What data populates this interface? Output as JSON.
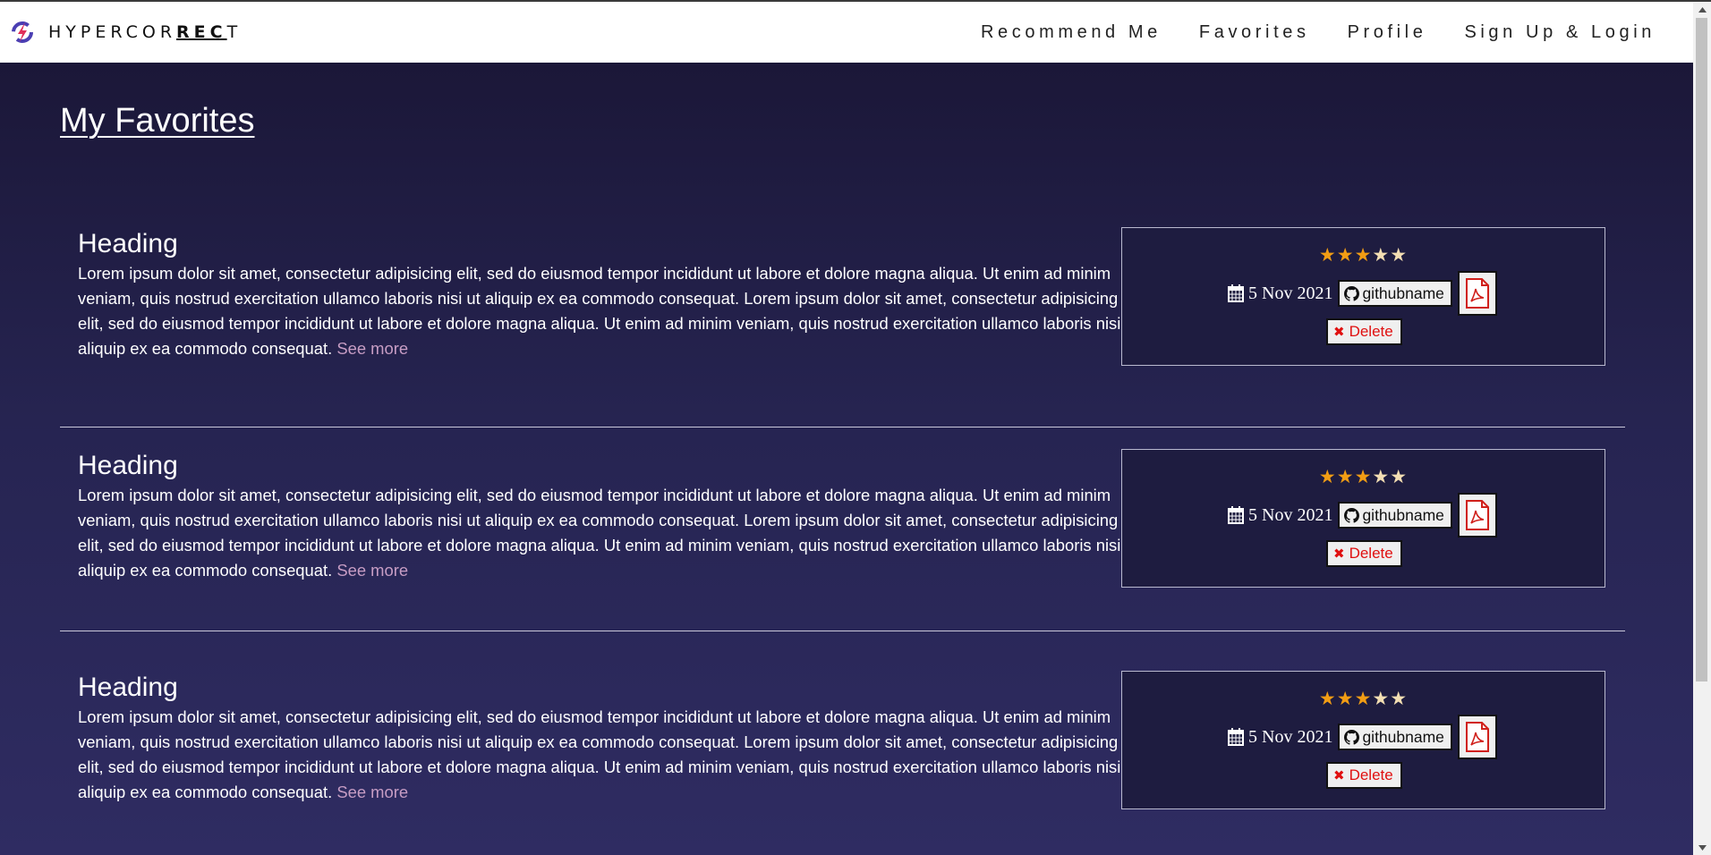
{
  "brand": {
    "name_start": "HYPERCOR",
    "name_bold": "REC",
    "name_end": "T",
    "logo_icon": "hypercorrect-logo-icon"
  },
  "nav": {
    "items": [
      {
        "label": "Recommend Me"
      },
      {
        "label": "Favorites"
      },
      {
        "label": "Profile"
      },
      {
        "label": "Sign Up & Login"
      }
    ]
  },
  "page": {
    "title": "My Favorites"
  },
  "cards": [
    {
      "heading": "Heading",
      "body": "Lorem ipsum dolor sit amet, consectetur adipisicing elit, sed do eiusmod tempor incididunt ut labore et dolore magna aliqua. Ut enim ad minim veniam, quis nostrud exercitation ullamco laboris nisi ut aliquip ex ea commodo consequat. Lorem ipsum dolor sit amet, consectetur adipisicing elit, sed do eiusmod tempor incididunt ut labore et dolore magna aliqua. Ut enim ad minim veniam, quis nostrud exercitation ullamco laboris nisi ut aliquip ex ea commodo consequat.",
      "see_more": "See more",
      "rating": 3,
      "rating_max": 5,
      "date": "5 Nov 2021",
      "github_label": "githubname",
      "delete_label": "Delete"
    },
    {
      "heading": "Heading",
      "body": "Lorem ipsum dolor sit amet, consectetur adipisicing elit, sed do eiusmod tempor incididunt ut labore et dolore magna aliqua. Ut enim ad minim veniam, quis nostrud exercitation ullamco laboris nisi ut aliquip ex ea commodo consequat. Lorem ipsum dolor sit amet, consectetur adipisicing elit, sed do eiusmod tempor incididunt ut labore et dolore magna aliqua. Ut enim ad minim veniam, quis nostrud exercitation ullamco laboris nisi ut aliquip ex ea commodo consequat.",
      "see_more": "See more",
      "rating": 3,
      "rating_max": 5,
      "date": "5 Nov 2021",
      "github_label": "githubname",
      "delete_label": "Delete"
    },
    {
      "heading": "Heading",
      "body": "Lorem ipsum dolor sit amet, consectetur adipisicing elit, sed do eiusmod tempor incididunt ut labore et dolore magna aliqua. Ut enim ad minim veniam, quis nostrud exercitation ullamco laboris nisi ut aliquip ex ea commodo consequat. Lorem ipsum dolor sit amet, consectetur adipisicing elit, sed do eiusmod tempor incididunt ut labore et dolore magna aliqua. Ut enim ad minim veniam, quis nostrud exercitation ullamco laboris nisi ut aliquip ex ea commodo consequat.",
      "see_more": "See more",
      "rating": 3,
      "rating_max": 5,
      "date": "5 Nov 2021",
      "github_label": "githubname",
      "delete_label": "Delete"
    }
  ],
  "icons": {
    "calendar": "calendar-icon",
    "github": "github-icon",
    "pdf": "pdf-file-icon",
    "delete": "x-icon",
    "star": "star-icon"
  },
  "colors": {
    "star_on": "#f29d14",
    "star_off": "#f3deb3",
    "see_more": "#c79dc4",
    "delete": "#e01010",
    "pdf": "#d0201b"
  }
}
